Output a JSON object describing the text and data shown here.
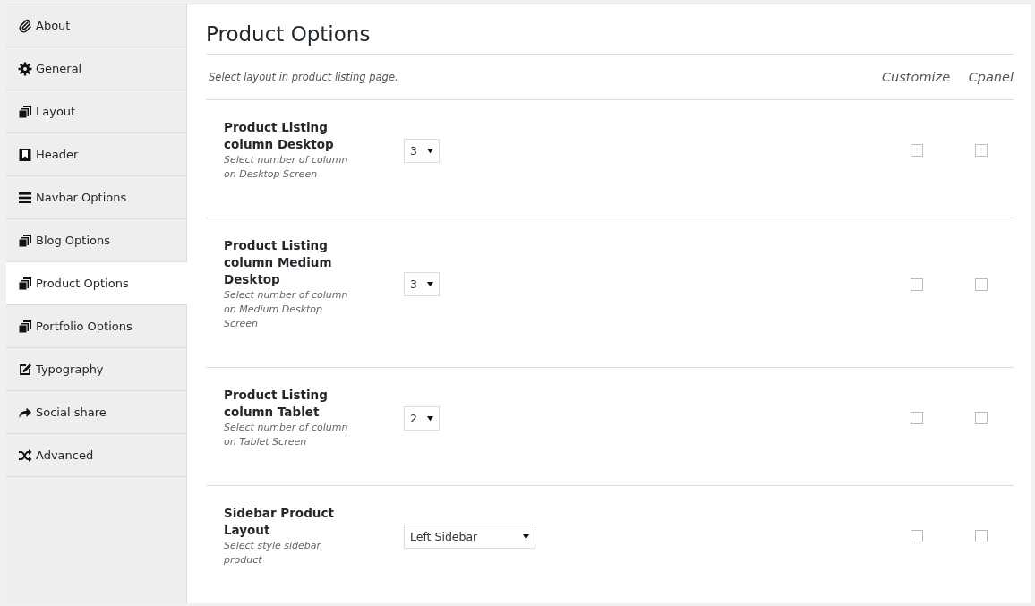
{
  "sidebar": {
    "items": [
      {
        "label": "About",
        "selected": false
      },
      {
        "label": "General",
        "selected": false
      },
      {
        "label": "Layout",
        "selected": false
      },
      {
        "label": "Header",
        "selected": false
      },
      {
        "label": "Navbar Options",
        "selected": false
      },
      {
        "label": "Blog Options",
        "selected": false
      },
      {
        "label": "Product Options",
        "selected": true
      },
      {
        "label": "Portfolio Options",
        "selected": false
      },
      {
        "label": "Typography",
        "selected": false
      },
      {
        "label": "Social share",
        "selected": false
      },
      {
        "label": "Advanced",
        "selected": false
      }
    ]
  },
  "panel": {
    "title": "Product Options",
    "intro": "Select layout in product listing page.",
    "columns": [
      "Customize",
      "Cpanel"
    ],
    "options": [
      {
        "label": "Product Listing column Desktop",
        "description": "Select number of column on Desktop Screen",
        "value": "3",
        "kind": "number",
        "customize": false,
        "cpanel": false
      },
      {
        "label": "Product Listing column Medium Desktop",
        "description": "Select number of column on Medium Desktop Screen",
        "value": "3",
        "kind": "number",
        "customize": false,
        "cpanel": false
      },
      {
        "label": "Product Listing column Tablet",
        "description": "Select number of column on Tablet Screen",
        "value": "2",
        "kind": "number",
        "customize": false,
        "cpanel": false
      },
      {
        "label": "Sidebar Product Layout",
        "description": "Select style sidebar product",
        "value": "Left Sidebar",
        "kind": "text",
        "customize": false,
        "cpanel": false
      }
    ]
  }
}
